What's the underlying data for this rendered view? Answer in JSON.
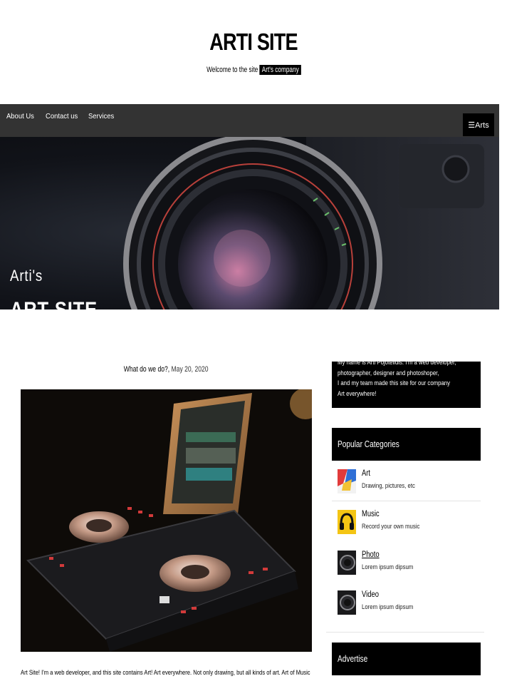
{
  "header": {
    "title": "ARTI SITE",
    "tagline_prefix": "Welcome to the site",
    "tagline_highlight": "Art's company"
  },
  "nav": {
    "links": [
      "About Us",
      "Contact us",
      "Services"
    ],
    "toggle_label": "☰Arts"
  },
  "hero": {
    "line1": "Arti's",
    "line2": "ART SITE"
  },
  "post": {
    "title": "What do we do?,",
    "date": "May 20, 2020",
    "excerpt": "Art Site! I'm a web developer, and this site contains Art! Art everywhere. Not only drawing, but all kinds of art. Art of Music"
  },
  "sidebar": {
    "about_lines": [
      "My name is Arti Pojotelidis. I'm a web developer,",
      "photographer, designer and photoshoper,",
      "I and my team made this site for our company",
      "Art everywhere!"
    ],
    "categories_header": "Popular Categories",
    "categories": [
      {
        "name": "Art",
        "desc": "Drawing, pictures, etc",
        "icon": "art-thumbnail"
      },
      {
        "name": "Music",
        "desc": "Record your own music",
        "icon": "headphones-thumbnail"
      },
      {
        "name": "Photo",
        "desc": "Lorem ipsum dipsum",
        "icon": "camera-thumbnail"
      },
      {
        "name": "Video",
        "desc": "Lorem ipsum dipsum",
        "icon": "camera-thumbnail"
      }
    ],
    "advertise_header": "Advertise"
  },
  "colors": {
    "navbar_bg": "#333333",
    "box_bg": "#000000",
    "text": "#000000"
  }
}
